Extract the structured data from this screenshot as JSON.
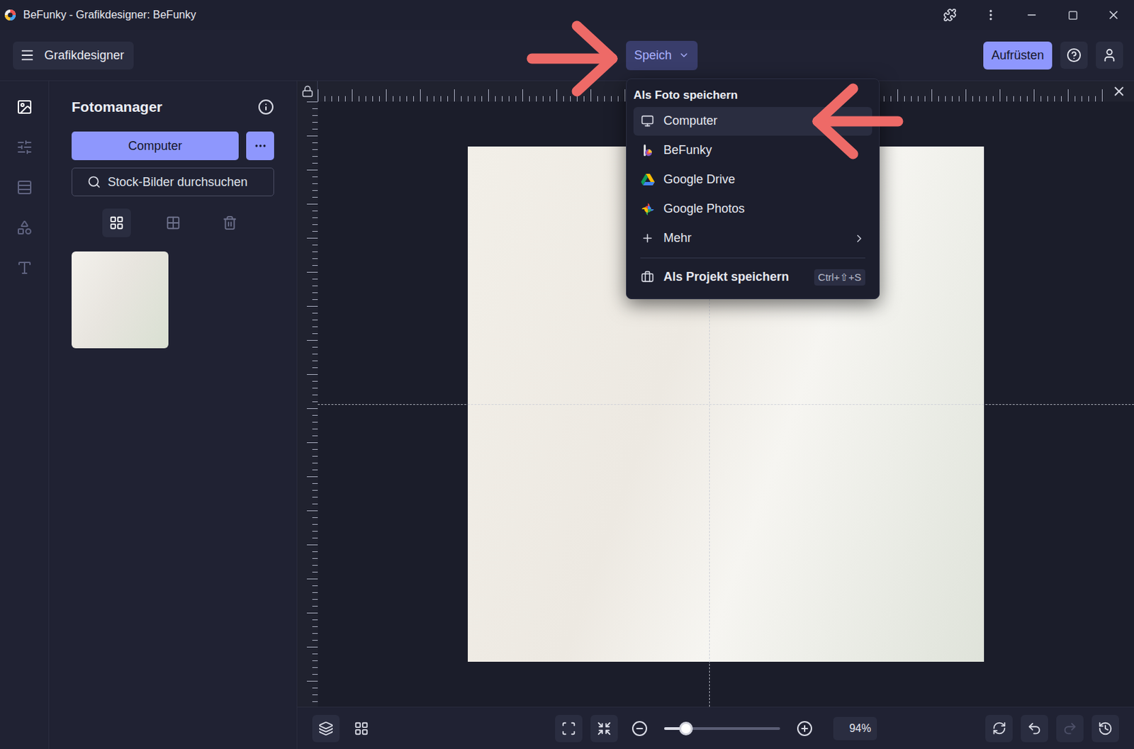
{
  "window": {
    "title": "BeFunky - Grafikdesigner: BeFunky"
  },
  "toolbar": {
    "menu_button": "Grafikdesigner",
    "save_button": {
      "label": "Speich",
      "expanded": true
    },
    "upgrade_button": "Aufrüsten"
  },
  "rail": {
    "items": [
      {
        "selected": true
      },
      {
        "selected": false
      },
      {
        "selected": false
      },
      {
        "selected": false
      },
      {
        "selected": false
      }
    ]
  },
  "panel": {
    "title": "Fotomanager",
    "upload_button": "Computer",
    "search": {
      "placeholder": "Stock-Bilder durchsuchen"
    },
    "views": [
      {
        "selected": true
      },
      {
        "selected": false
      }
    ]
  },
  "menu": {
    "header": "Als Foto speichern",
    "items": [
      {
        "label": "Computer",
        "hovered": true,
        "submenu": false
      },
      {
        "label": "BeFunky",
        "hovered": false,
        "submenu": false
      },
      {
        "label": "Google Drive",
        "hovered": false,
        "submenu": false
      },
      {
        "label": "Google Photos",
        "hovered": false,
        "submenu": false
      },
      {
        "label": "Mehr",
        "hovered": false,
        "submenu": true
      }
    ],
    "footer": {
      "label": "Als Projekt speichern",
      "shortcut": "Ctrl+⇧+S"
    }
  },
  "zoom": {
    "level": 0.19,
    "reading": "94%"
  },
  "history": {
    "undo": {
      "disabled": false
    },
    "redo": {
      "disabled": true
    }
  }
}
